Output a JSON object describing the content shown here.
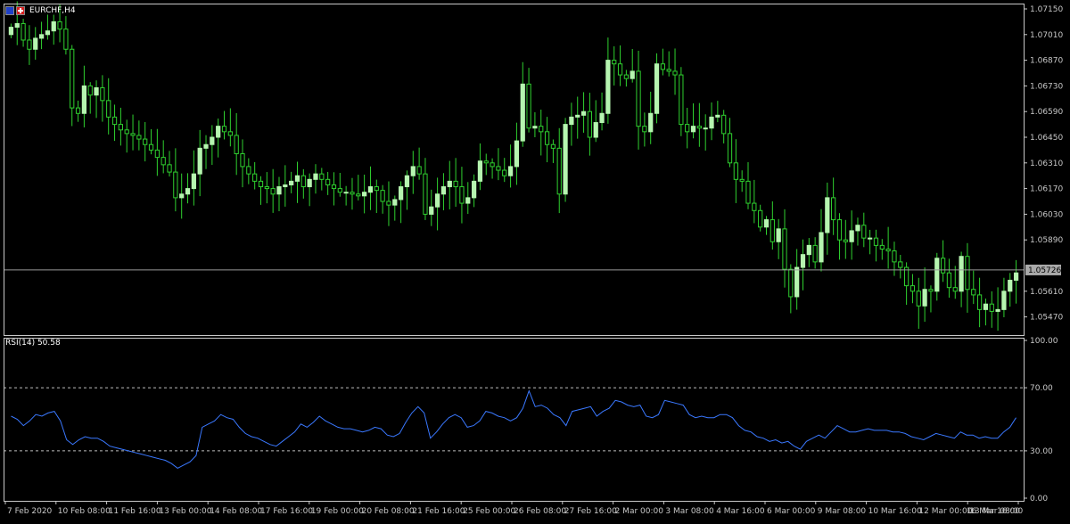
{
  "window": {
    "symbol_title": "EURCHF,H4"
  },
  "colors": {
    "background": "#000000",
    "frame": "#c8c8c8",
    "bull_candle": "#b6f5b0",
    "wick": "#2fd12f",
    "rsi_line": "#3a78ff",
    "price_line": "#9a9a9a",
    "price_tag_bg": "#a9a9a9"
  },
  "chart_data": [
    {
      "type": "candlestick",
      "title": "EURCHF,H4",
      "ylim": [
        1.054,
        1.0715
      ],
      "y_ticks": [
        "1.07150",
        "1.07010",
        "1.06870",
        "1.06730",
        "1.06590",
        "1.06450",
        "1.06310",
        "1.06170",
        "1.06030",
        "1.05890",
        "1.05610",
        "1.05470"
      ],
      "current_price": "1.05726",
      "x_tick_labels": [
        "7 Feb 2020",
        "10 Feb 08:00",
        "11 Feb 16:00",
        "13 Feb 00:00",
        "14 Feb 08:00",
        "17 Feb 16:00",
        "19 Feb 00:00",
        "20 Feb 08:00",
        "21 Feb 16:00",
        "25 Feb 00:00",
        "26 Feb 08:00",
        "27 Feb 16:00",
        "2 Mar 00:00",
        "3 Mar 08:00",
        "4 Mar 16:00",
        "6 Mar 00:00",
        "9 Mar 08:00",
        "10 Mar 16:00",
        "12 Mar 00:00",
        "13 Mar 08:00",
        "16 Mar 16:00"
      ],
      "close": [
        1.0705,
        1.0707,
        1.0698,
        1.0693,
        1.0699,
        1.0701,
        1.0703,
        1.0708,
        1.0704,
        1.0693,
        1.0661,
        1.0658,
        1.0673,
        1.0668,
        1.0672,
        1.0665,
        1.0656,
        1.0652,
        1.0649,
        1.0647,
        1.0646,
        1.0644,
        1.0641,
        1.0638,
        1.0634,
        1.063,
        1.0626,
        1.0612,
        1.0614,
        1.0617,
        1.0625,
        1.0639,
        1.0641,
        1.0645,
        1.0651,
        1.0648,
        1.0646,
        1.0636,
        1.0629,
        1.0625,
        1.0621,
        1.0618,
        1.0617,
        1.0614,
        1.0618,
        1.0619,
        1.0621,
        1.0624,
        1.0618,
        1.0622,
        1.0625,
        1.0622,
        1.0619,
        1.0617,
        1.0615,
        1.0615,
        1.0614,
        1.0613,
        1.0615,
        1.0618,
        1.0616,
        1.061,
        1.0608,
        1.0611,
        1.0618,
        1.0624,
        1.0629,
        1.0625,
        1.0603,
        1.0607,
        1.0614,
        1.0618,
        1.0621,
        1.0618,
        1.0609,
        1.0612,
        1.0621,
        1.0632,
        1.0631,
        1.0629,
        1.0627,
        1.0624,
        1.0629,
        1.0643,
        1.0674,
        1.065,
        1.0651,
        1.0648,
        1.0641,
        1.0639,
        1.0614,
        1.0652,
        1.0656,
        1.0657,
        1.0659,
        1.0645,
        1.0653,
        1.0658,
        1.0687,
        1.0685,
        1.0679,
        1.0677,
        1.0681,
        1.0651,
        1.0648,
        1.0658,
        1.0685,
        1.0682,
        1.0681,
        1.0679,
        1.0652,
        1.0648,
        1.0651,
        1.065,
        1.065,
        1.0656,
        1.0657,
        1.0647,
        1.0631,
        1.0622,
        1.0621,
        1.0609,
        1.0605,
        1.0596,
        1.06,
        1.0588,
        1.0595,
        1.0573,
        1.0558,
        1.0574,
        1.0581,
        1.0586,
        1.0577,
        1.0593,
        1.0612,
        1.06,
        1.0589,
        1.0588,
        1.0594,
        1.0597,
        1.059,
        1.059,
        1.0586,
        1.0584,
        1.0583,
        1.0577,
        1.0574,
        1.0564,
        1.0561,
        1.0553,
        1.0562,
        1.0561,
        1.0579,
        1.0571,
        1.0563,
        1.0561,
        1.058,
        1.0562,
        1.0559,
        1.0551,
        1.0554,
        1.055,
        1.0551,
        1.0561,
        1.0567,
        1.0571
      ]
    },
    {
      "type": "line",
      "title": "RSI(14) 50.58",
      "ylim": [
        0,
        100
      ],
      "y_ticks": [
        "100.00",
        "70.00",
        "30.00",
        "0.00"
      ],
      "levels": [
        70,
        30
      ],
      "values": [
        52,
        50,
        46,
        49,
        53,
        52,
        54,
        55,
        49,
        37,
        34,
        37,
        39,
        38,
        38,
        36,
        33,
        32,
        31,
        30,
        29,
        28,
        27,
        26,
        25,
        24,
        22,
        19,
        21,
        23,
        27,
        45,
        47,
        49,
        53,
        51,
        50,
        45,
        41,
        39,
        38,
        36,
        34,
        33,
        36,
        39,
        42,
        47,
        45,
        48,
        52,
        49,
        47,
        45,
        44,
        44,
        43,
        42,
        43,
        45,
        44,
        40,
        39,
        41,
        48,
        54,
        58,
        54,
        38,
        42,
        47,
        51,
        53,
        51,
        45,
        46,
        49,
        55,
        54,
        52,
        51,
        49,
        51,
        57,
        68,
        58,
        59,
        57,
        53,
        51,
        46,
        55,
        56,
        57,
        58,
        52,
        55,
        57,
        62,
        61,
        59,
        58,
        59,
        52,
        51,
        53,
        62,
        61,
        60,
        59,
        53,
        51,
        52,
        51,
        51,
        53,
        53,
        51,
        46,
        43,
        42,
        39,
        38,
        36,
        37,
        35,
        36,
        33,
        31,
        36,
        38,
        40,
        38,
        42,
        46,
        44,
        42,
        42,
        43,
        44,
        43,
        43,
        43,
        42,
        42,
        41,
        39,
        38,
        37,
        39,
        41,
        40,
        39,
        38,
        42,
        40,
        40,
        38,
        39,
        38,
        38,
        42,
        45,
        51
      ]
    }
  ]
}
